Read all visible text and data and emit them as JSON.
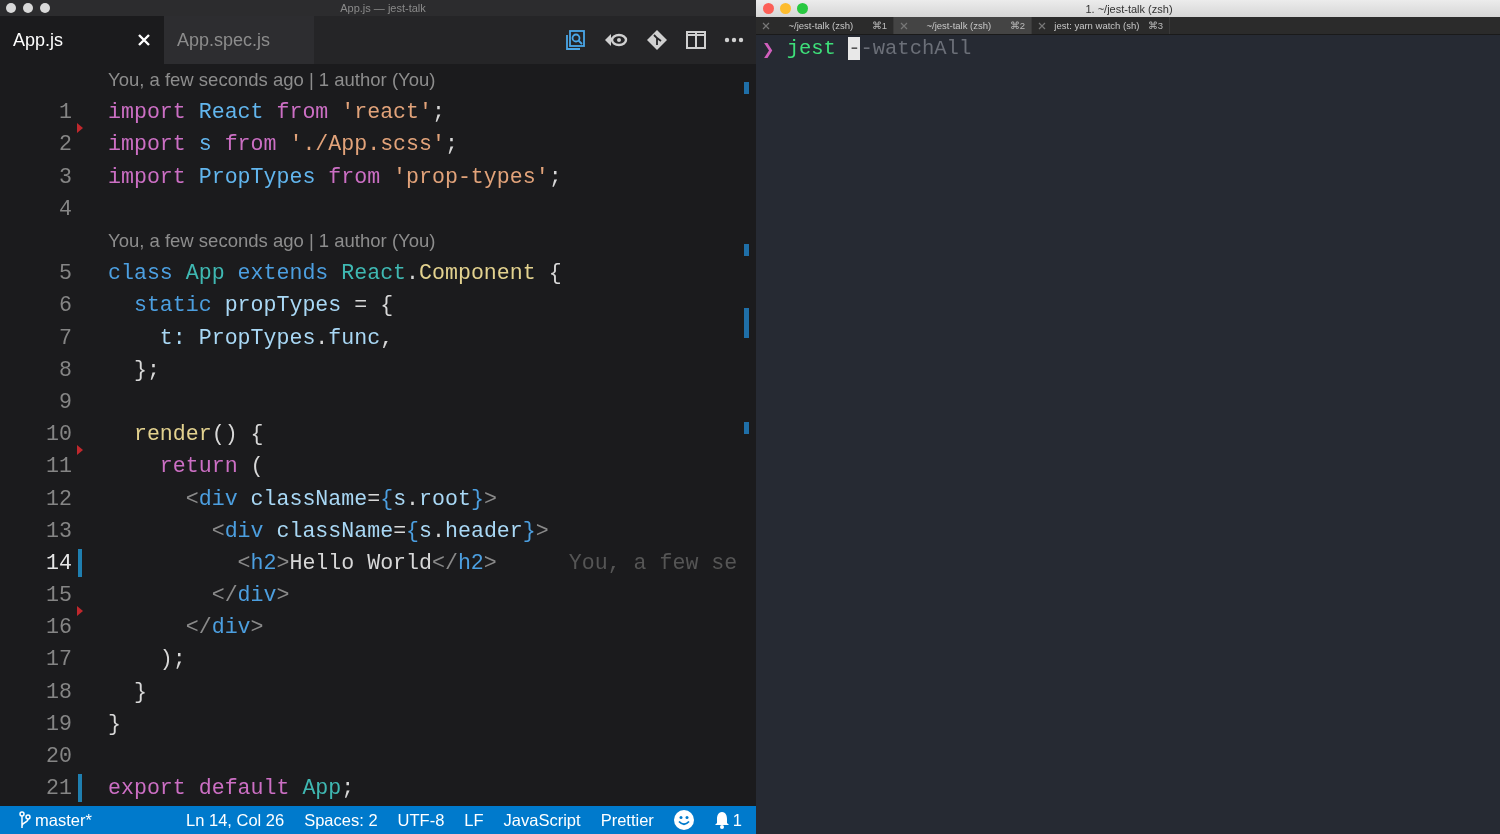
{
  "editor": {
    "window": {
      "title": "App.js — jest-talk"
    },
    "tabs": [
      {
        "label": "App.js",
        "selected": true
      },
      {
        "label": "App.spec.js",
        "selected": false
      }
    ],
    "lines": [
      {
        "kind": "blame",
        "text": "You, a few seconds ago | 1 author (You)"
      },
      {
        "kind": "code",
        "number": "1",
        "deleted_above": false,
        "modified": false,
        "current": false,
        "tokens": [
          {
            "kind": "kw",
            "text": "import"
          },
          {
            "kind": "type",
            "text": " React"
          },
          {
            "kind": "kw",
            "text": " from"
          },
          {
            "kind": "str",
            "text": " 'react'"
          },
          {
            "kind": "plain",
            "text": ";"
          }
        ]
      },
      {
        "kind": "code",
        "number": "2",
        "deleted_above": true,
        "modified": false,
        "current": false,
        "tokens": [
          {
            "kind": "kw",
            "text": "import"
          },
          {
            "kind": "type",
            "text": " s"
          },
          {
            "kind": "kw",
            "text": " from"
          },
          {
            "kind": "str",
            "text": " './App.scss'"
          },
          {
            "kind": "plain",
            "text": ";"
          }
        ]
      },
      {
        "kind": "code",
        "number": "3",
        "deleted_above": false,
        "modified": false,
        "current": false,
        "tokens": [
          {
            "kind": "kw",
            "text": "import"
          },
          {
            "kind": "type",
            "text": " PropTypes"
          },
          {
            "kind": "kw",
            "text": " from"
          },
          {
            "kind": "str",
            "text": " 'prop-types'"
          },
          {
            "kind": "plain",
            "text": ";"
          }
        ]
      },
      {
        "kind": "code",
        "number": "4",
        "deleted_above": false,
        "modified": false,
        "current": false
      },
      {
        "kind": "blame",
        "text": "You, a few seconds ago | 1 author (You)"
      },
      {
        "kind": "code",
        "number": "5",
        "deleted_above": false,
        "modified": false,
        "current": false,
        "tokens": [
          {
            "kind": "decl",
            "text": "class"
          },
          {
            "kind": "cls",
            "text": " App"
          },
          {
            "kind": "decl",
            "text": " extends"
          },
          {
            "kind": "cls",
            "text": " React"
          },
          {
            "kind": "plain",
            "text": "."
          },
          {
            "kind": "fn",
            "text": "Component"
          },
          {
            "kind": "plain",
            "text": " {"
          }
        ]
      },
      {
        "kind": "code",
        "number": "6",
        "deleted_above": false,
        "modified": false,
        "current": false,
        "tokens": [
          {
            "kind": "decl",
            "text": "  static"
          },
          {
            "kind": "prop",
            "text": " propTypes"
          },
          {
            "kind": "plain",
            "text": " = {"
          }
        ]
      },
      {
        "kind": "code",
        "number": "7",
        "deleted_above": false,
        "modified": false,
        "current": false,
        "tokens": [
          {
            "kind": "prop",
            "text": "    t:"
          },
          {
            "kind": "prop",
            "text": " PropTypes"
          },
          {
            "kind": "plain",
            "text": "."
          },
          {
            "kind": "prop",
            "text": "func"
          },
          {
            "kind": "plain",
            "text": ","
          }
        ]
      },
      {
        "kind": "code",
        "number": "8",
        "deleted_above": false,
        "modified": false,
        "current": false,
        "tokens": [
          {
            "kind": "plain",
            "text": "  };"
          }
        ]
      },
      {
        "kind": "code",
        "number": "9",
        "deleted_above": false,
        "modified": false,
        "current": false
      },
      {
        "kind": "code",
        "number": "10",
        "deleted_above": false,
        "modified": false,
        "current": false,
        "tokens": [
          {
            "kind": "fn",
            "text": "  render"
          },
          {
            "kind": "plain",
            "text": "() {"
          }
        ]
      },
      {
        "kind": "code",
        "number": "11",
        "deleted_above": true,
        "modified": false,
        "current": false,
        "tokens": [
          {
            "kind": "kw",
            "text": "    return"
          },
          {
            "kind": "plain",
            "text": " ("
          }
        ]
      },
      {
        "kind": "code",
        "number": "12",
        "deleted_above": false,
        "modified": false,
        "current": false,
        "tokens": [
          {
            "kind": "bracket",
            "text": "      <"
          },
          {
            "kind": "tag",
            "text": "div"
          },
          {
            "kind": "prop",
            "text": " className"
          },
          {
            "kind": "plain",
            "text": "="
          },
          {
            "kind": "tag",
            "text": "{"
          },
          {
            "kind": "prop",
            "text": "s"
          },
          {
            "kind": "plain",
            "text": "."
          },
          {
            "kind": "prop",
            "text": "root"
          },
          {
            "kind": "tag",
            "text": "}"
          },
          {
            "kind": "bracket",
            "text": ">"
          }
        ]
      },
      {
        "kind": "code",
        "number": "13",
        "deleted_above": false,
        "modified": false,
        "current": false,
        "tokens": [
          {
            "kind": "bracket",
            "text": "        <"
          },
          {
            "kind": "tag",
            "text": "div"
          },
          {
            "kind": "prop",
            "text": " className"
          },
          {
            "kind": "plain",
            "text": "="
          },
          {
            "kind": "tag",
            "text": "{"
          },
          {
            "kind": "prop",
            "text": "s"
          },
          {
            "kind": "plain",
            "text": "."
          },
          {
            "kind": "prop",
            "text": "header"
          },
          {
            "kind": "tag",
            "text": "}"
          },
          {
            "kind": "bracket",
            "text": ">"
          }
        ]
      },
      {
        "kind": "code",
        "number": "14",
        "deleted_above": false,
        "modified": true,
        "current": true,
        "inline_blame": "You, a few se",
        "tokens": [
          {
            "kind": "bracket",
            "text": "          <"
          },
          {
            "kind": "tag",
            "text": "h2"
          },
          {
            "kind": "bracket",
            "text": ">"
          },
          {
            "kind": "plain",
            "text": "Hello World"
          },
          {
            "kind": "bracket",
            "text": "</"
          },
          {
            "kind": "tag",
            "text": "h2"
          },
          {
            "kind": "bracket",
            "text": ">"
          }
        ]
      },
      {
        "kind": "code",
        "number": "15",
        "deleted_above": false,
        "modified": false,
        "current": false,
        "tokens": [
          {
            "kind": "bracket",
            "text": "        </"
          },
          {
            "kind": "tag",
            "text": "div"
          },
          {
            "kind": "bracket",
            "text": ">"
          }
        ]
      },
      {
        "kind": "code",
        "number": "16",
        "deleted_above": true,
        "modified": false,
        "current": false,
        "tokens": [
          {
            "kind": "bracket",
            "text": "      </"
          },
          {
            "kind": "tag",
            "text": "div"
          },
          {
            "kind": "bracket",
            "text": ">"
          }
        ]
      },
      {
        "kind": "code",
        "number": "17",
        "deleted_above": false,
        "modified": false,
        "current": false,
        "tokens": [
          {
            "kind": "plain",
            "text": "    );"
          }
        ]
      },
      {
        "kind": "code",
        "number": "18",
        "deleted_above": false,
        "modified": false,
        "current": false,
        "tokens": [
          {
            "kind": "plain",
            "text": "  }"
          }
        ]
      },
      {
        "kind": "code",
        "number": "19",
        "deleted_above": false,
        "modified": false,
        "current": false,
        "tokens": [
          {
            "kind": "plain",
            "text": "}"
          }
        ]
      },
      {
        "kind": "code",
        "number": "20",
        "deleted_above": false,
        "modified": false,
        "current": false
      },
      {
        "kind": "code",
        "number": "21",
        "deleted_above": false,
        "modified": true,
        "current": false,
        "tokens": [
          {
            "kind": "kw",
            "text": "export"
          },
          {
            "kind": "kw",
            "text": " default"
          },
          {
            "kind": "cls",
            "text": " App"
          },
          {
            "kind": "plain",
            "text": ";"
          }
        ]
      }
    ],
    "status_bar": {
      "branch": "master*",
      "items": [
        "Ln 14, Col 26",
        "Spaces: 2",
        "UTF-8",
        "LF",
        "JavaScript",
        "Prettier"
      ],
      "notifications": "1"
    }
  },
  "terminal": {
    "window": {
      "title": "1. ~/jest-talk (zsh)"
    },
    "tabs": [
      {
        "label": "~/jest-talk (zsh)",
        "shortcut": "⌘1",
        "selected": false
      },
      {
        "label": "~/jest-talk (zsh)",
        "shortcut": "⌘2",
        "selected": true
      },
      {
        "label": "jest: yarn watch (sh)",
        "shortcut": "⌘3",
        "selected": false
      }
    ],
    "prompt": "❯",
    "command": "jest",
    "suggestion": "--watchAll"
  }
}
